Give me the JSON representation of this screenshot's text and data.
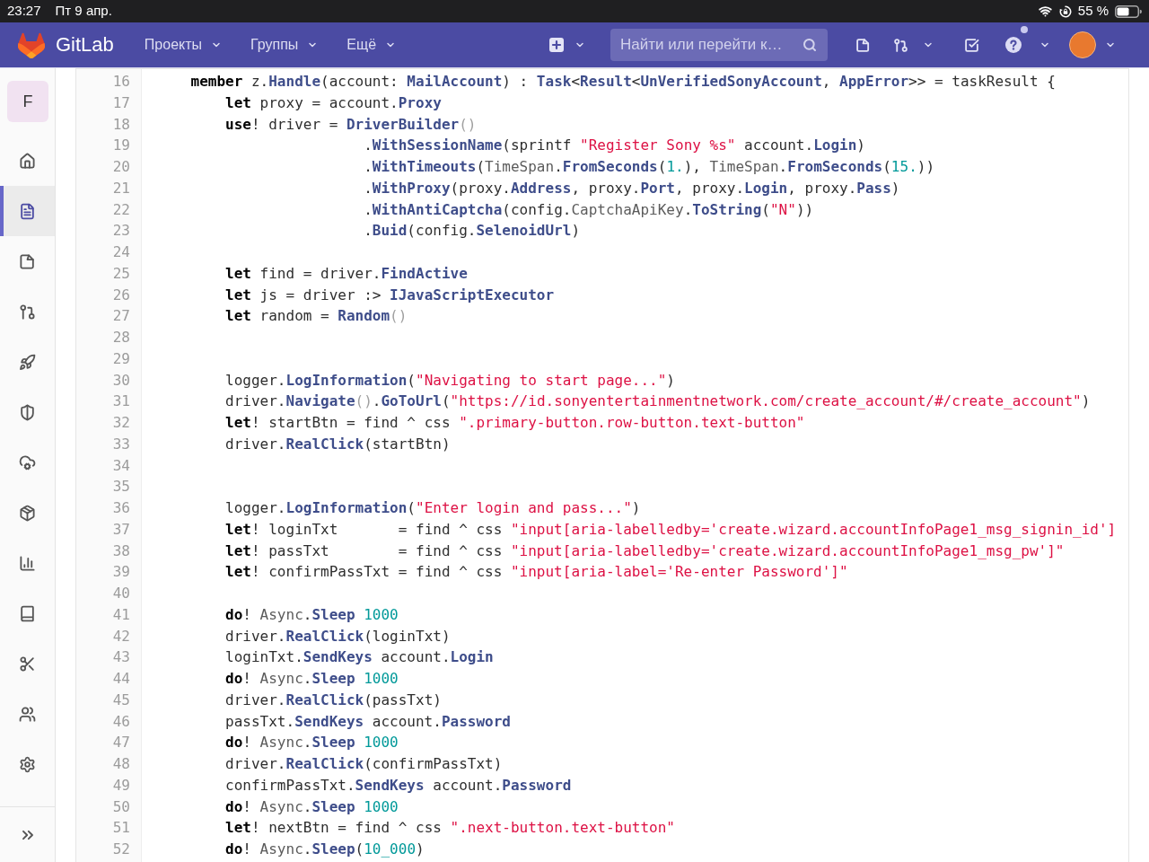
{
  "status_bar": {
    "time": "23:27",
    "date": "Пт 9 апр.",
    "battery": "55 %"
  },
  "navbar": {
    "brand": "GitLab",
    "menus": [
      {
        "label": "Проекты"
      },
      {
        "label": "Группы"
      },
      {
        "label": "Ещё"
      }
    ],
    "search": {
      "placeholder": "Найти или перейти к…"
    }
  },
  "sidebar": {
    "project_initial": "F",
    "items": [
      {
        "kind": "home",
        "selected": false
      },
      {
        "kind": "file",
        "selected": true
      },
      {
        "kind": "issues",
        "selected": false
      },
      {
        "kind": "merge",
        "selected": false
      },
      {
        "kind": "rocket",
        "selected": false
      },
      {
        "kind": "shield",
        "selected": false
      },
      {
        "kind": "cloud",
        "selected": false
      },
      {
        "kind": "package",
        "selected": false
      },
      {
        "kind": "chart",
        "selected": false
      },
      {
        "kind": "book",
        "selected": false
      },
      {
        "kind": "scissors",
        "selected": false
      },
      {
        "kind": "members",
        "selected": false
      },
      {
        "kind": "settings",
        "selected": false
      }
    ]
  },
  "code": {
    "lines": [
      {
        "number": "16",
        "tokens": [
          {
            "kind": "keyword",
            "text": "    member"
          },
          {
            "kind": "plain",
            "text": " z."
          },
          {
            "kind": "name",
            "text": "Handle"
          },
          {
            "kind": "plain",
            "text": "(account: "
          },
          {
            "kind": "name",
            "text": "MailAccount"
          },
          {
            "kind": "plain",
            "text": ") : "
          },
          {
            "kind": "name",
            "text": "Task"
          },
          {
            "kind": "plain",
            "text": "<"
          },
          {
            "kind": "name",
            "text": "Result"
          },
          {
            "kind": "plain",
            "text": "<"
          },
          {
            "kind": "name",
            "text": "UnVerifiedSonyAccount"
          },
          {
            "kind": "plain",
            "text": ", "
          },
          {
            "kind": "name",
            "text": "AppError"
          },
          {
            "kind": "plain",
            "text": ">> = taskResult {"
          }
        ]
      },
      {
        "number": "17",
        "tokens": [
          {
            "kind": "keyword",
            "text": "        let"
          },
          {
            "kind": "plain",
            "text": " proxy = account."
          },
          {
            "kind": "name",
            "text": "Proxy"
          }
        ]
      },
      {
        "number": "18",
        "tokens": [
          {
            "kind": "keyword",
            "text": "        use"
          },
          {
            "kind": "plain",
            "text": "! driver = "
          },
          {
            "kind": "name",
            "text": "DriverBuilder"
          },
          {
            "kind": "paren",
            "text": "()"
          }
        ]
      },
      {
        "number": "19",
        "tokens": [
          {
            "kind": "plain",
            "text": "                        ."
          },
          {
            "kind": "name",
            "text": "WithSessionName"
          },
          {
            "kind": "plain",
            "text": "(sprintf "
          },
          {
            "kind": "string",
            "text": "\"Register Sony %s\""
          },
          {
            "kind": "plain",
            "text": " account."
          },
          {
            "kind": "name",
            "text": "Login"
          },
          {
            "kind": "plain",
            "text": ")"
          }
        ]
      },
      {
        "number": "20",
        "tokens": [
          {
            "kind": "plain",
            "text": "                        ."
          },
          {
            "kind": "name",
            "text": "WithTimeouts"
          },
          {
            "kind": "plain",
            "text": "("
          },
          {
            "kind": "dim",
            "text": "TimeSpan"
          },
          {
            "kind": "plain",
            "text": "."
          },
          {
            "kind": "name",
            "text": "FromSeconds"
          },
          {
            "kind": "plain",
            "text": "("
          },
          {
            "kind": "number",
            "text": "1."
          },
          {
            "kind": "plain",
            "text": "), "
          },
          {
            "kind": "dim",
            "text": "TimeSpan"
          },
          {
            "kind": "plain",
            "text": "."
          },
          {
            "kind": "name",
            "text": "FromSeconds"
          },
          {
            "kind": "plain",
            "text": "("
          },
          {
            "kind": "number",
            "text": "15."
          },
          {
            "kind": "plain",
            "text": "))"
          }
        ]
      },
      {
        "number": "21",
        "tokens": [
          {
            "kind": "plain",
            "text": "                        ."
          },
          {
            "kind": "name",
            "text": "WithProxy"
          },
          {
            "kind": "plain",
            "text": "(proxy."
          },
          {
            "kind": "name",
            "text": "Address"
          },
          {
            "kind": "plain",
            "text": ", proxy."
          },
          {
            "kind": "name",
            "text": "Port"
          },
          {
            "kind": "plain",
            "text": ", proxy."
          },
          {
            "kind": "name",
            "text": "Login"
          },
          {
            "kind": "plain",
            "text": ", proxy."
          },
          {
            "kind": "name",
            "text": "Pass"
          },
          {
            "kind": "plain",
            "text": ")"
          }
        ]
      },
      {
        "number": "22",
        "tokens": [
          {
            "kind": "plain",
            "text": "                        ."
          },
          {
            "kind": "name",
            "text": "WithAntiCaptcha"
          },
          {
            "kind": "plain",
            "text": "(config."
          },
          {
            "kind": "dim",
            "text": "CaptchaApiKey"
          },
          {
            "kind": "plain",
            "text": "."
          },
          {
            "kind": "name",
            "text": "ToString"
          },
          {
            "kind": "plain",
            "text": "("
          },
          {
            "kind": "string",
            "text": "\"N\""
          },
          {
            "kind": "plain",
            "text": "))"
          }
        ]
      },
      {
        "number": "23",
        "tokens": [
          {
            "kind": "plain",
            "text": "                        ."
          },
          {
            "kind": "name",
            "text": "Buid"
          },
          {
            "kind": "plain",
            "text": "(config."
          },
          {
            "kind": "name",
            "text": "SelenoidUrl"
          },
          {
            "kind": "plain",
            "text": ")"
          }
        ]
      },
      {
        "number": "24"
      },
      {
        "number": "25",
        "tokens": [
          {
            "kind": "keyword",
            "text": "        let"
          },
          {
            "kind": "plain",
            "text": " find = driver."
          },
          {
            "kind": "name",
            "text": "FindActive"
          }
        ]
      },
      {
        "number": "26",
        "tokens": [
          {
            "kind": "keyword",
            "text": "        let"
          },
          {
            "kind": "plain",
            "text": " js = driver :> "
          },
          {
            "kind": "name",
            "text": "IJavaScriptExecutor"
          }
        ]
      },
      {
        "number": "27",
        "tokens": [
          {
            "kind": "keyword",
            "text": "        let"
          },
          {
            "kind": "plain",
            "text": " random = "
          },
          {
            "kind": "name",
            "text": "Random"
          },
          {
            "kind": "paren",
            "text": "()"
          }
        ]
      },
      {
        "number": "28"
      },
      {
        "number": "29"
      },
      {
        "number": "30",
        "tokens": [
          {
            "kind": "plain",
            "text": "        logger."
          },
          {
            "kind": "name",
            "text": "LogInformation"
          },
          {
            "kind": "plain",
            "text": "("
          },
          {
            "kind": "string",
            "text": "\"Navigating to start page...\""
          },
          {
            "kind": "plain",
            "text": ")"
          }
        ]
      },
      {
        "number": "31",
        "tokens": [
          {
            "kind": "plain",
            "text": "        driver."
          },
          {
            "kind": "name",
            "text": "Navigate"
          },
          {
            "kind": "paren",
            "text": "()"
          },
          {
            "kind": "plain",
            "text": "."
          },
          {
            "kind": "name",
            "text": "GoToUrl"
          },
          {
            "kind": "plain",
            "text": "("
          },
          {
            "kind": "string",
            "text": "\"https://id.sonyentertainmentnetwork.com/create_account/#/create_account\""
          },
          {
            "kind": "plain",
            "text": ")"
          }
        ]
      },
      {
        "number": "32",
        "tokens": [
          {
            "kind": "keyword",
            "text": "        let"
          },
          {
            "kind": "plain",
            "text": "! startBtn = find ^ css "
          },
          {
            "kind": "string",
            "text": "\".primary-button.row-button.text-button\""
          }
        ]
      },
      {
        "number": "33",
        "tokens": [
          {
            "kind": "plain",
            "text": "        driver."
          },
          {
            "kind": "name",
            "text": "RealClick"
          },
          {
            "kind": "plain",
            "text": "(startBtn)"
          }
        ]
      },
      {
        "number": "34"
      },
      {
        "number": "35"
      },
      {
        "number": "36",
        "tokens": [
          {
            "kind": "plain",
            "text": "        logger."
          },
          {
            "kind": "name",
            "text": "LogInformation"
          },
          {
            "kind": "plain",
            "text": "("
          },
          {
            "kind": "string",
            "text": "\"Enter login and pass...\""
          },
          {
            "kind": "plain",
            "text": ")"
          }
        ]
      },
      {
        "number": "37",
        "tokens": [
          {
            "kind": "keyword",
            "text": "        let"
          },
          {
            "kind": "plain",
            "text": "! loginTxt       = find ^ css "
          },
          {
            "kind": "string",
            "text": "\"input[aria-labelledby='create.wizard.accountInfoPage1_msg_signin_id']"
          }
        ]
      },
      {
        "number": "38",
        "tokens": [
          {
            "kind": "keyword",
            "text": "        let"
          },
          {
            "kind": "plain",
            "text": "! passTxt        = find ^ css "
          },
          {
            "kind": "string",
            "text": "\"input[aria-labelledby='create.wizard.accountInfoPage1_msg_pw']\""
          }
        ]
      },
      {
        "number": "39",
        "tokens": [
          {
            "kind": "keyword",
            "text": "        let"
          },
          {
            "kind": "plain",
            "text": "! confirmPassTxt = find ^ css "
          },
          {
            "kind": "string",
            "text": "\"input[aria-label='Re-enter Password']\""
          }
        ]
      },
      {
        "number": "40"
      },
      {
        "number": "41",
        "tokens": [
          {
            "kind": "keyword",
            "text": "        do"
          },
          {
            "kind": "plain",
            "text": "! "
          },
          {
            "kind": "dim",
            "text": "Async"
          },
          {
            "kind": "plain",
            "text": "."
          },
          {
            "kind": "name",
            "text": "Sleep"
          },
          {
            "kind": "number",
            "text": " 1000"
          }
        ]
      },
      {
        "number": "42",
        "tokens": [
          {
            "kind": "plain",
            "text": "        driver."
          },
          {
            "kind": "name",
            "text": "RealClick"
          },
          {
            "kind": "plain",
            "text": "(loginTxt)"
          }
        ]
      },
      {
        "number": "43",
        "tokens": [
          {
            "kind": "plain",
            "text": "        loginTxt."
          },
          {
            "kind": "name",
            "text": "SendKeys"
          },
          {
            "kind": "plain",
            "text": " account."
          },
          {
            "kind": "name",
            "text": "Login"
          }
        ]
      },
      {
        "number": "44",
        "tokens": [
          {
            "kind": "keyword",
            "text": "        do"
          },
          {
            "kind": "plain",
            "text": "! "
          },
          {
            "kind": "dim",
            "text": "Async"
          },
          {
            "kind": "plain",
            "text": "."
          },
          {
            "kind": "name",
            "text": "Sleep"
          },
          {
            "kind": "number",
            "text": " 1000"
          }
        ]
      },
      {
        "number": "45",
        "tokens": [
          {
            "kind": "plain",
            "text": "        driver."
          },
          {
            "kind": "name",
            "text": "RealClick"
          },
          {
            "kind": "plain",
            "text": "(passTxt)"
          }
        ]
      },
      {
        "number": "46",
        "tokens": [
          {
            "kind": "plain",
            "text": "        passTxt."
          },
          {
            "kind": "name",
            "text": "SendKeys"
          },
          {
            "kind": "plain",
            "text": " account."
          },
          {
            "kind": "name",
            "text": "Password"
          }
        ]
      },
      {
        "number": "47",
        "tokens": [
          {
            "kind": "keyword",
            "text": "        do"
          },
          {
            "kind": "plain",
            "text": "! "
          },
          {
            "kind": "dim",
            "text": "Async"
          },
          {
            "kind": "plain",
            "text": "."
          },
          {
            "kind": "name",
            "text": "Sleep"
          },
          {
            "kind": "number",
            "text": " 1000"
          }
        ]
      },
      {
        "number": "48",
        "tokens": [
          {
            "kind": "plain",
            "text": "        driver."
          },
          {
            "kind": "name",
            "text": "RealClick"
          },
          {
            "kind": "plain",
            "text": "(confirmPassTxt)"
          }
        ]
      },
      {
        "number": "49",
        "tokens": [
          {
            "kind": "plain",
            "text": "        confirmPassTxt."
          },
          {
            "kind": "name",
            "text": "SendKeys"
          },
          {
            "kind": "plain",
            "text": " account."
          },
          {
            "kind": "name",
            "text": "Password"
          }
        ]
      },
      {
        "number": "50",
        "tokens": [
          {
            "kind": "keyword",
            "text": "        do"
          },
          {
            "kind": "plain",
            "text": "! "
          },
          {
            "kind": "dim",
            "text": "Async"
          },
          {
            "kind": "plain",
            "text": "."
          },
          {
            "kind": "name",
            "text": "Sleep"
          },
          {
            "kind": "number",
            "text": " 1000"
          }
        ]
      },
      {
        "number": "51",
        "tokens": [
          {
            "kind": "keyword",
            "text": "        let"
          },
          {
            "kind": "plain",
            "text": "! nextBtn = find ^ css "
          },
          {
            "kind": "string",
            "text": "\".next-button.text-button\""
          }
        ]
      },
      {
        "number": "52",
        "tokens": [
          {
            "kind": "keyword",
            "text": "        do"
          },
          {
            "kind": "plain",
            "text": "! "
          },
          {
            "kind": "dim",
            "text": "Async"
          },
          {
            "kind": "plain",
            "text": "."
          },
          {
            "kind": "name",
            "text": "Sleep"
          },
          {
            "kind": "plain",
            "text": "("
          },
          {
            "kind": "number",
            "text": "10_000"
          },
          {
            "kind": "plain",
            "text": ")"
          }
        ]
      }
    ]
  }
}
